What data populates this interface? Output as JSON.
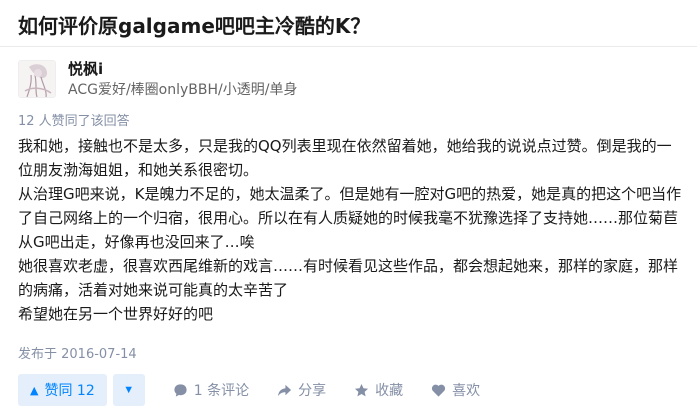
{
  "question": {
    "title": "如何评价原galgame吧吧主冷酷的K？"
  },
  "author": {
    "name": "悦枫i",
    "bio": "ACG爱好/棒圈onlyBBH/小透明/单身",
    "avatar_icon": "avatar-image"
  },
  "answer": {
    "votes_text": "12 人赞同了该回答",
    "paragraphs": [
      "我和她，接触也不是太多，只是我的QQ列表里现在依然留着她，她给我的说说点过赞。倒是我的一位朋友渤海姐姐，和她关系很密切。",
      "从治理G吧来说，K是魄力不足的，她太温柔了。但是她有一腔对G吧的热爱，她是真的把这个吧当作了自己网络上的一个归宿，很用心。所以在有人质疑她的时候我毫不犹豫选择了支持她……那位菊苣从G吧出走，好像再也没回来了…唉",
      "她很喜欢老虚，很喜欢西尾维新的戏言……有时候看见这些作品，都会想起她来，那样的家庭，那样的病痛，活着对她来说可能真的太辛苦了",
      "希望她在另一个世界好好的吧"
    ],
    "date": "发布于 2016-07-14"
  },
  "actions": {
    "vote_up_label": "赞同 12",
    "comments_label": "1 条评论",
    "share_label": "分享",
    "collect_label": "收藏",
    "like_label": "喜欢"
  },
  "colors": {
    "accent": "#0084ff",
    "accent_bg": "#e5eefb",
    "meta_gray": "#8590a6"
  }
}
